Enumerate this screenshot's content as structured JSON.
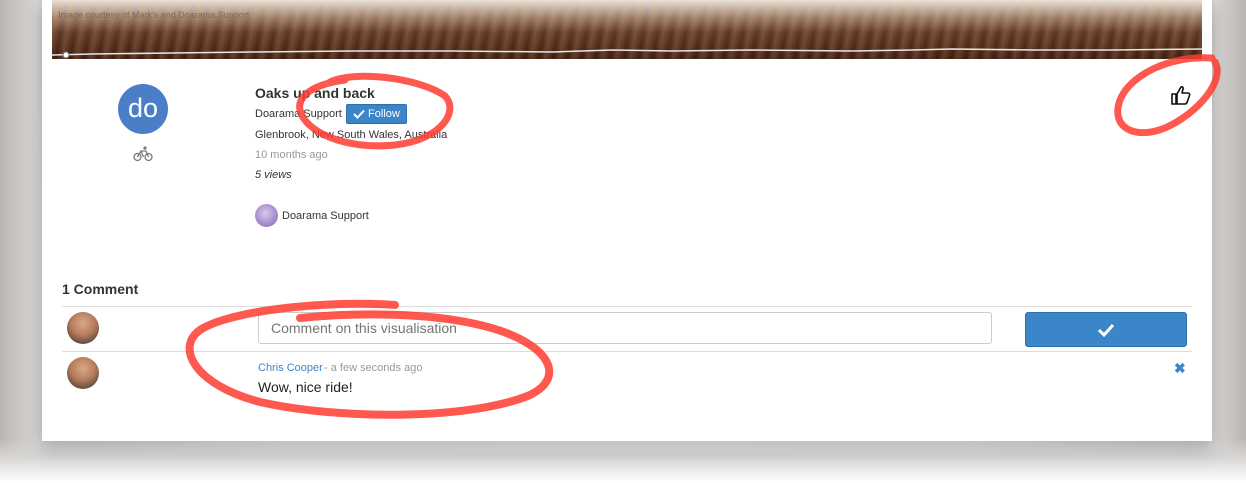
{
  "banner": {
    "credit": "Image courtesy of Mark's and Doarama Support"
  },
  "visualisation": {
    "avatar_initials": "do",
    "activity_icon": "bicycle-icon",
    "title": "Oaks up and back",
    "author": "Doarama Support",
    "follow_label": "Follow",
    "location": "Glenbrook, New South Wales, Australia",
    "date": "10 months ago",
    "views": "5 views",
    "owner_name": "Doarama Support",
    "like_icon": "thumbs-up-icon"
  },
  "comments": {
    "heading": "1 Comment",
    "input_placeholder": "Comment on this visualisation",
    "submit_icon": "check-icon",
    "items": [
      {
        "author": "Chris Cooper",
        "time": " - a few seconds ago",
        "text": "Wow, nice ride!"
      }
    ]
  },
  "colors": {
    "accent": "#3b86c9",
    "annotation": "#ff3b2f",
    "avatar_bg": "#4a7fc8"
  }
}
